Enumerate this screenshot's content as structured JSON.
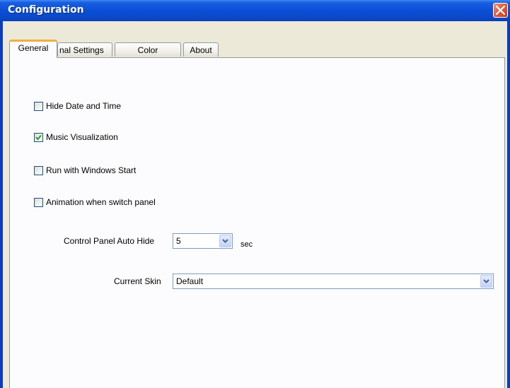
{
  "window": {
    "title": "Configuration"
  },
  "tabs": [
    {
      "label": "General",
      "active": true
    },
    {
      "label": "nal Settings",
      "active": false
    },
    {
      "label": "Color",
      "active": false
    },
    {
      "label": "About",
      "active": false
    }
  ],
  "options": [
    {
      "label": "Hide Date and Time",
      "checked": false
    },
    {
      "label": "Music Visualization",
      "checked": true
    },
    {
      "label": "Run with Windows Start",
      "checked": false
    },
    {
      "label": "Animation when switch panel",
      "checked": false
    }
  ],
  "auto_hide": {
    "label": "Control Panel Auto Hide",
    "value": "5",
    "unit": "sec"
  },
  "skin": {
    "label": "Current Skin",
    "value": "Default"
  },
  "colors": {
    "title_bar": "#0a48c8",
    "tab_highlight": "#f0b040",
    "close_button": "#e06040"
  }
}
